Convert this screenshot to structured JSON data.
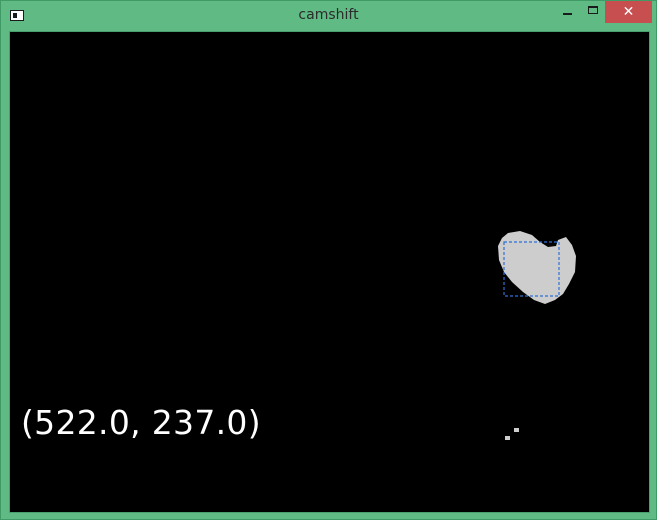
{
  "window": {
    "title": "camshift",
    "icons": {
      "app": "app-window-icon",
      "minimize": "minimize-icon",
      "maximize": "maximize-icon",
      "close": "close-icon"
    },
    "colors": {
      "frame": "#5fba83",
      "close_button": "#c74f4f",
      "canvas": "#000000",
      "blob": "#cdcdcd",
      "track_box": "#2e6fd6",
      "coord_text": "#ffffff"
    }
  },
  "overlay": {
    "coordinates_text": "(522.0, 237.0)"
  }
}
